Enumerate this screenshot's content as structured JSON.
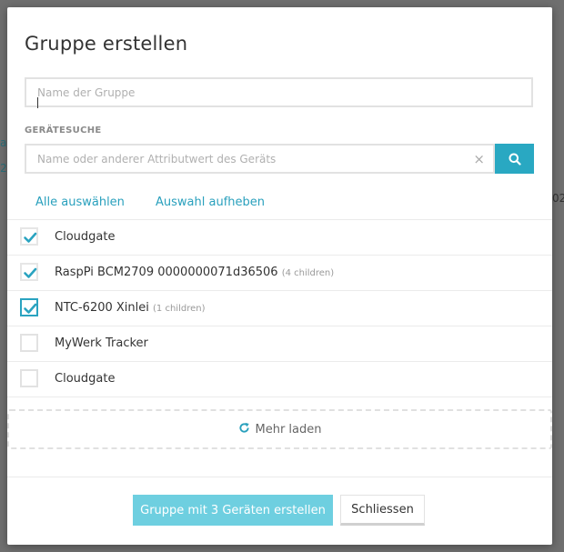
{
  "background": {
    "fragments": [
      "a",
      "2",
      "02"
    ]
  },
  "dialog": {
    "title": "Gruppe erstellen",
    "name_field": {
      "placeholder": "Name der Gruppe",
      "value": ""
    },
    "search": {
      "label": "GERÄTESUCHE",
      "placeholder": "Name oder anderer Attributwert des Geräts",
      "clear_glyph": "×",
      "icon": "search-icon"
    },
    "links": {
      "select_all": "Alle auswählen",
      "deselect_all": "Auswahl aufheben"
    },
    "devices": [
      {
        "name": "Cloudgate",
        "children": "",
        "checked": true
      },
      {
        "name": "RaspPi BCM2709 0000000071d36506",
        "children": "(4 children)",
        "checked": true
      },
      {
        "name": "NTC-6200 Xinlei",
        "children": "(1 children)",
        "checked": true
      },
      {
        "name": "MyWerk Tracker",
        "children": "",
        "checked": false
      },
      {
        "name": "Cloudgate",
        "children": "",
        "checked": false
      }
    ],
    "load_more": {
      "icon": "refresh-icon",
      "label": "Mehr laden"
    },
    "footer": {
      "create_button": "Gruppe mit 3 Geräten erstellen",
      "close_button": "Schliessen"
    },
    "colors": {
      "accent": "#29a8c2",
      "primary_button": "#6ecfe0",
      "check": "#2aa3c0"
    }
  }
}
